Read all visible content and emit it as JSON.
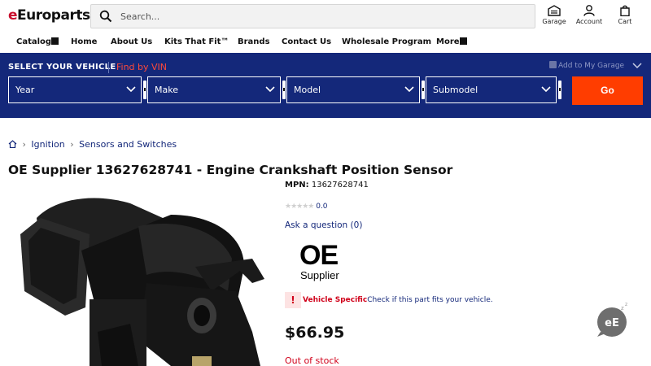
{
  "header": {
    "logo_prefix": "e",
    "logo_rest": "Europarts",
    "search_placeholder": "Search...",
    "garage_label": "Garage",
    "account_label": "Account",
    "cart_label": "Cart"
  },
  "nav": {
    "items": [
      "Catalog",
      "Home",
      "About Us",
      "Kits That Fit™",
      "Brands",
      "Contact Us",
      "Wholesale Program",
      "More"
    ]
  },
  "vehicle_selector": {
    "title": "SELECT YOUR VEHICLE",
    "vin_link": "Find by VIN",
    "add_to_garage": "Add to My Garage",
    "selects": [
      "Year",
      "Make",
      "Model",
      "Submodel"
    ],
    "go_label": "Go",
    "colors": {
      "background": "#14287a",
      "go": "#ff3d00",
      "vin": "#ff4a3a"
    }
  },
  "breadcrumb": [
    "Ignition",
    "Sensors and Switches"
  ],
  "product": {
    "title": "OE Supplier 13627628741 - Engine Crankshaft Position Sensor",
    "mpn_label": "MPN:",
    "mpn_value": "13627628741",
    "rating": "0.0",
    "ask_question": "Ask a question (0)",
    "brand_logo_top": "OE",
    "brand_logo_bottom": "Supplier",
    "vehicle_specific_label": "Vehicle Specific",
    "vehicle_specific_msg": "Check if this part fits your vehicle.",
    "price": "$66.95",
    "stock_status": "Out of stock"
  },
  "chat": {
    "label": "eE"
  }
}
